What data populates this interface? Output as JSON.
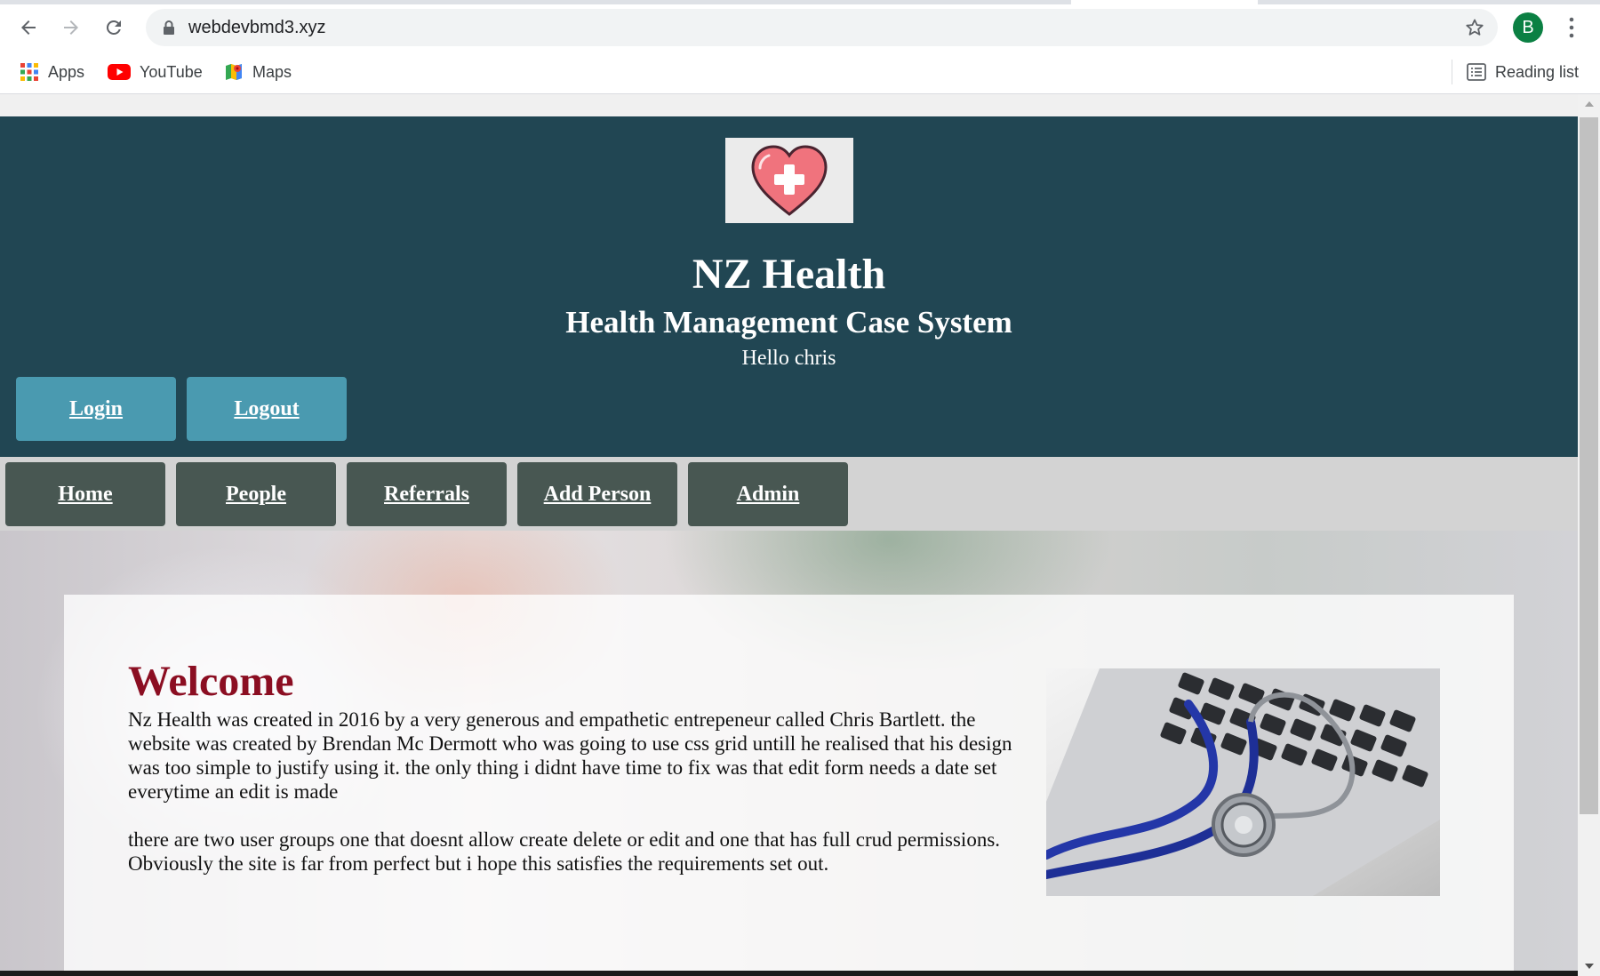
{
  "browser": {
    "url": "webdevbmd3.xyz",
    "profile_initial": "B",
    "bookmarks": [
      {
        "label": "Apps"
      },
      {
        "label": "YouTube"
      },
      {
        "label": "Maps"
      }
    ],
    "reading_list_label": "Reading list"
  },
  "site": {
    "title": "NZ Health",
    "subtitle": "Health Management Case System",
    "greeting": "Hello chris",
    "auth_buttons": [
      {
        "label": "Login"
      },
      {
        "label": "Logout"
      }
    ],
    "nav_items": [
      {
        "label": "Home"
      },
      {
        "label": "People"
      },
      {
        "label": "Referrals"
      },
      {
        "label": "Add Person"
      },
      {
        "label": "Admin"
      }
    ]
  },
  "content": {
    "heading": "Welcome",
    "paragraph_1": "Nz Health was created in 2016 by a very generous and empathetic entrepeneur called Chris Bartlett. the website was created by Brendan Mc Dermott who was going to use css grid untill he realised that his design was too simple to justify using it. the only thing i didnt have time to fix was that edit form needs a date set everytime an edit is made",
    "paragraph_2": "there are two user groups one that doesnt allow create delete or edit and one that has full crud permissions. Obviously the site is far from perfect but i hope this satisfies the requirements set out."
  },
  "colors": {
    "header_bg": "#214653",
    "auth_button_bg": "#4a9ab0",
    "nav_bar_bg": "#d3d3d3",
    "nav_item_bg": "#485752",
    "welcome_heading": "#8b0e22",
    "profile_avatar": "#0b8043"
  },
  "icons": [
    "back-arrow-icon",
    "forward-arrow-icon",
    "reload-icon",
    "lock-icon",
    "star-icon",
    "kebab-menu-icon",
    "apps-grid-icon",
    "youtube-icon",
    "maps-icon",
    "reading-list-icon",
    "heart-cross-logo",
    "stethoscope-laptop-image"
  ]
}
